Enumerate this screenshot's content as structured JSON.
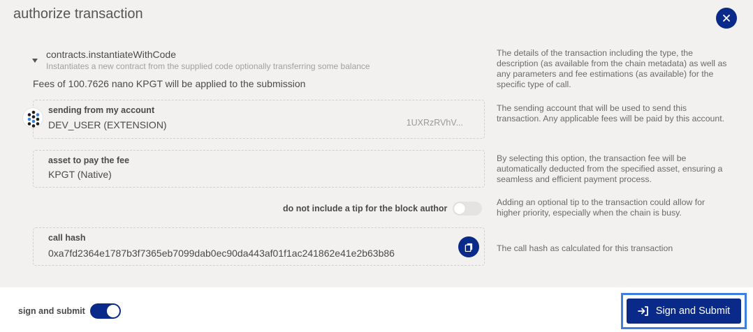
{
  "modal": {
    "title": "authorize transaction"
  },
  "call": {
    "name": "contracts.instantiateWithCode",
    "description": "Instantiates a new contract from the supplied code optionally transferring some balance",
    "fees": "Fees of 100.7626 nano KPGT will be applied to the submission",
    "help": "The details of the transaction including the type, the description (as available from the chain metadata) as well as any parameters and fee estimations (as available) for the specific type of call."
  },
  "account": {
    "label": "sending from my account",
    "name": "DEV_USER (EXTENSION)",
    "address": "1UXRzRVhV...",
    "help": "The sending account that will be used to send this transaction. Any applicable fees will be paid by this account."
  },
  "fee_asset": {
    "label": "asset to pay the fee",
    "value": "KPGT (Native)",
    "help": "By selecting this option, the transaction fee will be automatically deducted from the specified asset, ensuring a seamless and efficient payment process."
  },
  "tip": {
    "label": "do not include a tip for the block author",
    "enabled": false,
    "help": "Adding an optional tip to the transaction could allow for higher priority, especially when the chain is busy."
  },
  "call_hash": {
    "label": "call hash",
    "value": "0xa7fd2364e1787b3f7365eb7099dab0ec90da443af01f1ac241862e41e2b63b86",
    "help": "The call hash as calculated for this transaction"
  },
  "footer": {
    "sign_label": "sign and submit",
    "sign_enabled": true,
    "submit_label": "Sign and Submit"
  },
  "colors": {
    "accent": "#0a2a8a",
    "focus_ring": "#3d7ee0",
    "background": "#f2f1f0"
  },
  "icons": {
    "close": "close-icon",
    "caret": "caret-down-icon",
    "copy": "copy-icon",
    "submit": "sign-in-icon",
    "avatar": "identicon"
  }
}
